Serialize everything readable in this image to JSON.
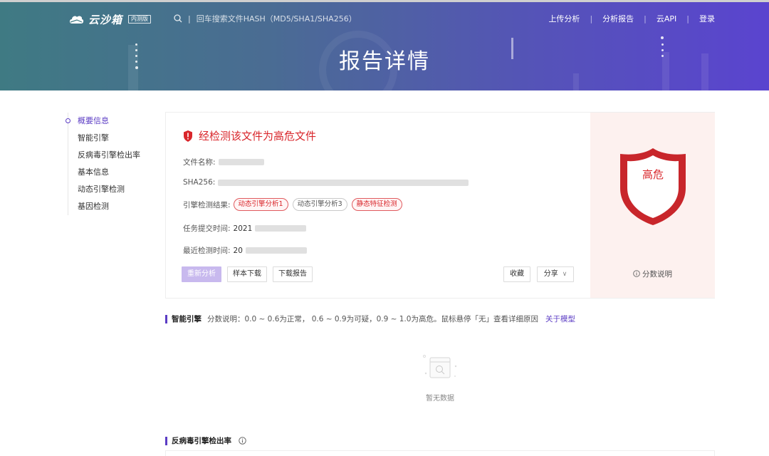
{
  "header": {
    "logo_text": "云沙箱",
    "logo_badge": "内测版",
    "search_placeholder": "回车搜索文件HASH（MD5/SHA1/SHA256）",
    "nav": [
      "上传分析",
      "分析报告",
      "云API",
      "登录"
    ],
    "title": "报告详情"
  },
  "sidebar": {
    "items": [
      {
        "label": "概要信息",
        "active": true
      },
      {
        "label": "智能引擎"
      },
      {
        "label": "反病毒引擎检出率"
      },
      {
        "label": "基本信息"
      },
      {
        "label": "动态引擎检测"
      },
      {
        "label": "基因检测"
      }
    ]
  },
  "report": {
    "verdict": "经检测该文件为高危文件",
    "file_name_label": "文件名称:",
    "sha256_label": "SHA256:",
    "engine_result_label": "引擎检测结果:",
    "engine_tags": [
      {
        "label": "动态引擎分析1",
        "style": "red"
      },
      {
        "label": "动态引擎分析3",
        "style": "gray"
      },
      {
        "label": "静态特征检测",
        "style": "red"
      }
    ],
    "submit_time_label": "任务提交时间:",
    "submit_time_visible": "2021",
    "recent_time_label": "最近检测时间:",
    "recent_time_visible": "20",
    "buttons": {
      "reanalyze": "重新分析",
      "download_sample": "样本下载",
      "download_report": "下载报告",
      "favorite": "收藏",
      "share": "分享"
    },
    "risk_level": "高危",
    "score_explain": "分数说明"
  },
  "sections": {
    "smart_engine": {
      "title": "智能引擎",
      "desc": "分数说明：0.0 ~ 0.6为正常， 0.6 ~ 0.9为可疑，0.9 ~ 1.0为高危。鼠标悬停「无」查看详细原因",
      "link": "关于模型",
      "empty_text": "暂无数据"
    },
    "antivirus": {
      "title": "反病毒引擎检出率"
    }
  },
  "colors": {
    "brand": "#5b3cc4",
    "danger": "#d9262b",
    "risk_bg": "#fdf1ef"
  }
}
